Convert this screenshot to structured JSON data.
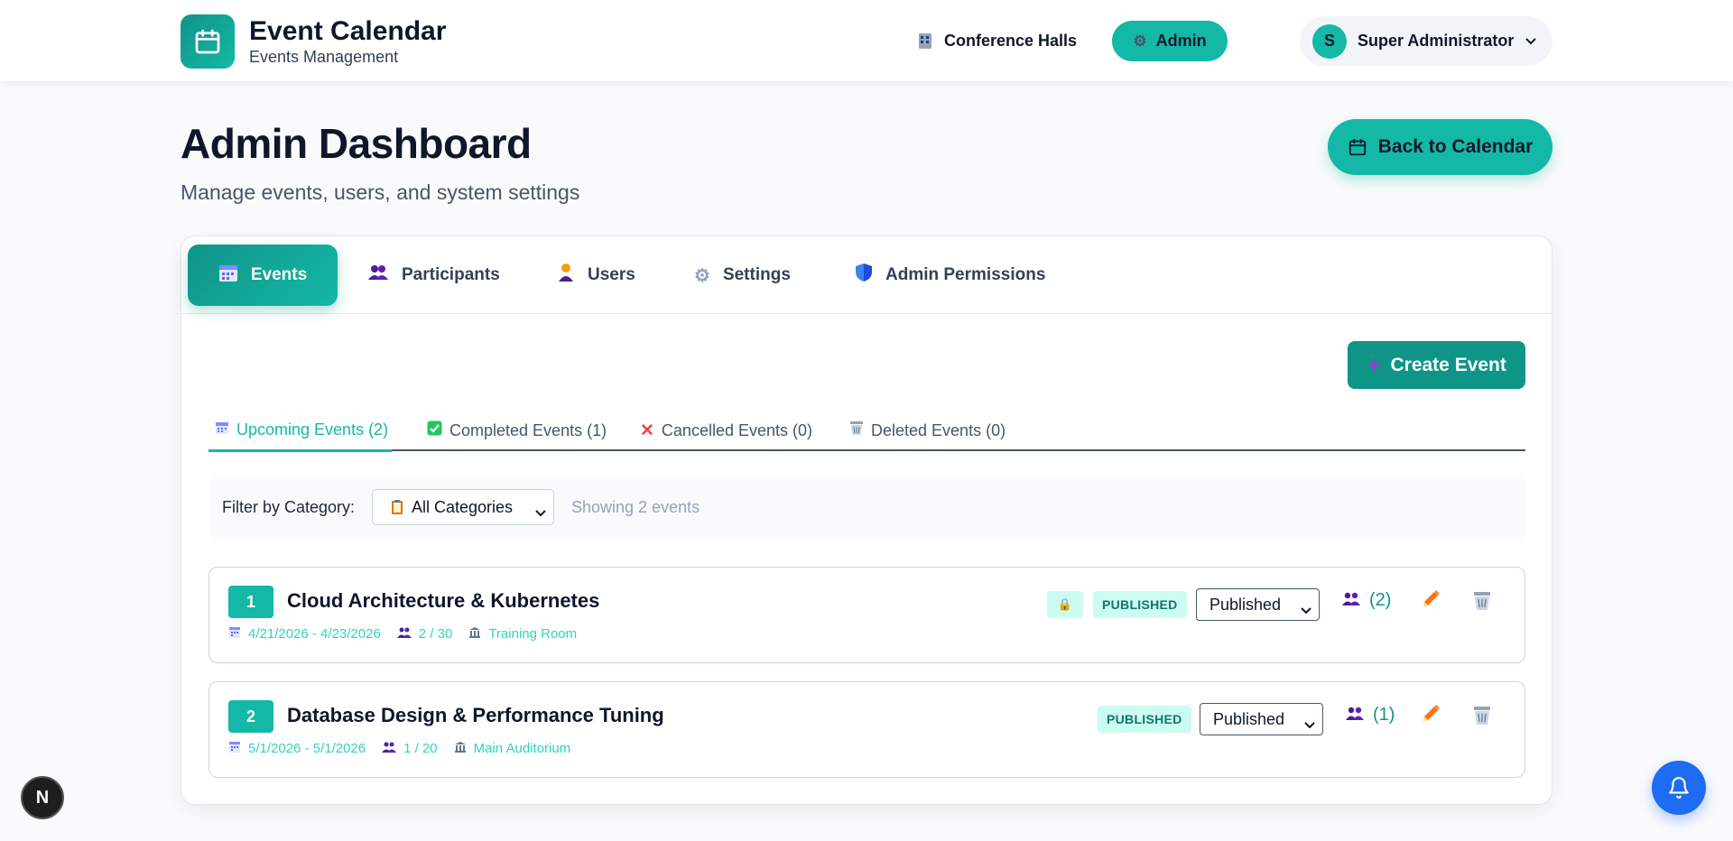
{
  "header": {
    "title": "Event Calendar",
    "subtitle": "Events Management",
    "nav": {
      "halls_label": "Conference Halls",
      "admin_label": "Admin"
    },
    "user": {
      "initial": "S",
      "name": "Super Administrator"
    }
  },
  "page": {
    "title": "Admin Dashboard",
    "subtitle": "Manage events, users, and system settings",
    "back_button": "Back to Calendar"
  },
  "tabs": [
    {
      "label": "Events",
      "icon": "calendar-icon",
      "active": true
    },
    {
      "label": "Participants",
      "icon": "people-icon"
    },
    {
      "label": "Users",
      "icon": "user-icon"
    },
    {
      "label": "Settings",
      "icon": "gear-icon"
    },
    {
      "label": "Admin Permissions",
      "icon": "shield-icon"
    }
  ],
  "create_button": "Create Event",
  "subtabs": [
    {
      "label": "Upcoming Events (2)",
      "icon": "calendar-icon",
      "active": true
    },
    {
      "label": "Completed Events (1)",
      "icon": "check-icon"
    },
    {
      "label": "Cancelled Events (0)",
      "icon": "cross-icon"
    },
    {
      "label": "Deleted Events (0)",
      "icon": "trash-icon"
    }
  ],
  "filter": {
    "label": "Filter by Category:",
    "selected": "All Categories",
    "count_text": "Showing 2 events"
  },
  "events": [
    {
      "number": "1",
      "title": "Cloud Architecture & Kubernetes",
      "dates": "4/21/2026 - 4/23/2026",
      "capacity": "2 / 30",
      "location": "Training Room",
      "locked": true,
      "badge": "PUBLISHED",
      "status": "Published",
      "participants": "(2)"
    },
    {
      "number": "2",
      "title": "Database Design & Performance Tuning",
      "dates": "5/1/2026 - 5/1/2026",
      "capacity": "1 / 20",
      "location": "Main Auditorium",
      "locked": false,
      "badge": "PUBLISHED",
      "status": "Published",
      "participants": "(1)"
    }
  ],
  "floating": {
    "dev_badge": "N"
  },
  "colors": {
    "accent": "#14b8a6",
    "accent_dark": "#0f9488",
    "badge_bg": "#ccfbf1",
    "bell": "#1d6cf2"
  }
}
